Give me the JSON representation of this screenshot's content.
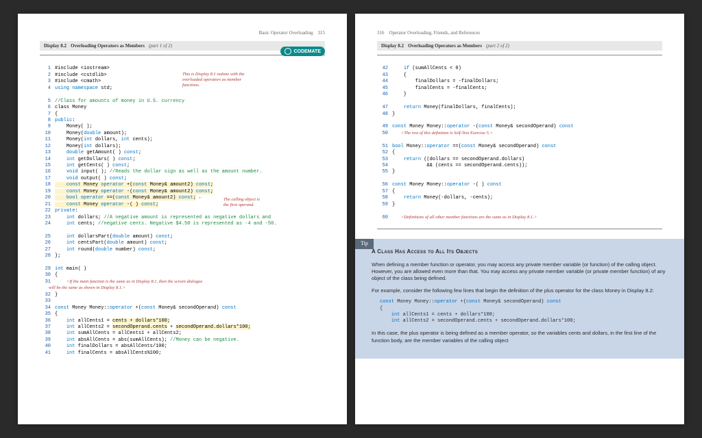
{
  "left": {
    "header_title": "Basic Operator Overloading",
    "header_page": "315",
    "display_label": "Display 8.2",
    "display_title": "Overloading Operators as Members",
    "display_part": "(part 1 of 2)",
    "badge": "CODEMATE",
    "callout1": "This is Display 8.1 redone with the\noverloaded operators as member\nfunctions.",
    "callout2": "The calling object is\nthe first operand.",
    "note_main": "<If the main function is the same as in Display 8.1, then the screen dialogue\n        will be the same as shown in Display 8.1.>",
    "lines": {
      "1": "#include <iostream>",
      "2": "#include <cstdlib>",
      "3": "#include <cmath>",
      "4_a": "using namespace",
      "4_b": " std;",
      "5": "//Class for amounts of money in U.S. currency",
      "6": "class Money",
      "7": "{",
      "8": "public",
      "9": "    Money( );",
      "10_a": "    Money(",
      "10_b": "double",
      "10_c": " amount);",
      "11_a": "    Money(",
      "11_b": "int",
      "11_c": " dollars, ",
      "11_d": "int",
      "11_e": " cents);",
      "12_a": "    Money(",
      "12_b": "int",
      "12_c": " dollars);",
      "13_a": "    ",
      "13_b": "double",
      "13_c": " getAmount( ) ",
      "13_d": "const",
      "14_a": "    ",
      "14_b": "int",
      "14_c": " getDollars( ) ",
      "14_d": "const",
      "15_a": "    ",
      "15_b": "int",
      "15_c": " getCents( ) ",
      "15_d": "const",
      "16_a": "    ",
      "16_b": "void",
      "16_c": " input( ); ",
      "16_d": "//Reads the dollar sign as well as the amount number.",
      "17_a": "    ",
      "17_b": "void",
      "17_c": " output( ) ",
      "17_d": "const",
      "18_a": "    ",
      "18_b": "const",
      "18_c": " Money ",
      "18_d": "operator",
      "18_e": " +(",
      "18_f": "const",
      "18_g": " Money& amount2) ",
      "18_h": "const",
      "19_a": "    ",
      "19_b": "const",
      "19_c": " Money ",
      "19_d": "operator",
      "19_e": " -(",
      "19_f": "const",
      "19_g": " Money& amount2) ",
      "19_h": "const",
      "20_a": "    ",
      "20_b": "bool operator",
      "20_c": " ==(",
      "20_d": "const",
      "20_e": " Money& amount2) ",
      "20_f": "const",
      "21_a": "    ",
      "21_b": "const",
      "21_c": " Money ",
      "21_d": "operator",
      "21_e": " -( ) ",
      "21_f": "const",
      "22": "private",
      "23_a": "    ",
      "23_b": "int",
      "23_c": " dollars; ",
      "23_d": "//A negative amount is represented as negative dollars and",
      "24_a": "    ",
      "24_b": "int",
      "24_c": " cents; ",
      "24_d": "//negative cents. Negative $4.50 is represented as -4 and -50.",
      "25_a": "    ",
      "25_b": "int",
      "25_c": " dollarsPart(",
      "25_d": "double",
      "25_e": " amount) ",
      "25_f": "const",
      "26_a": "    ",
      "26_b": "int",
      "26_c": " centsPart(",
      "26_d": "double",
      "26_e": " amount) ",
      "26_f": "const",
      "27_a": "    ",
      "27_b": "int",
      "27_c": " round(",
      "27_d": "double",
      "27_e": " number) ",
      "27_f": "const",
      "28": "};",
      "29_a": "int",
      "29_b": " main( )",
      "30": "{",
      "32": "}",
      "33": "",
      "34_a": "const",
      "34_b": " Money Money::",
      "34_c": "operator",
      "34_d": " +(",
      "34_e": "const",
      "34_f": " Money& secondOperand) ",
      "34_g": "const",
      "35": "{",
      "36_a": "    ",
      "36_b": "int",
      "36_c": " allCents1 = ",
      "36_d": "cents + dollars*100;",
      "37_a": "    ",
      "37_b": "int",
      "37_c": " allCents2 = ",
      "37_d": "secondOperand.cents",
      "37_e": " + ",
      "37_f": "secondOperand.dollars*100;",
      "38_a": "    ",
      "38_b": "int",
      "38_c": " sumAllCents = allCents1 + allCents2;",
      "39_a": "    ",
      "39_b": "int",
      "39_c": " absAllCents = abs(sumAllCents); ",
      "39_d": "//Money can be negative.",
      "40_a": "    ",
      "40_b": "int",
      "40_c": " finalDollars = absAllCents/100;",
      "41_a": "    ",
      "41_b": "int",
      "41_c": " finalCents = absAllCents%100;"
    }
  },
  "right": {
    "header_page": "316",
    "header_title": "Operator Overloading, Friends, and References",
    "display_label": "Display 8.2",
    "display_title": "Overloading Operators as Members",
    "display_part": "(part 2 of 2)",
    "lines": {
      "42_a": "    ",
      "42_b": "if",
      "42_c": " (sumAllCents < 0)",
      "43": "    {",
      "44": "        finalDollars = -finalDollars;",
      "45": "        finalCents = -finalCents;",
      "46": "    }",
      "47_a": "    ",
      "47_b": "return",
      "47_c": " Money(finalDollars, finalCents);",
      "48": "}",
      "49_a": "const",
      "49_b": " Money Money::",
      "49_c": "operator",
      "49_d": " -(",
      "49_e": "const",
      "49_f": " Money& secondOperand) ",
      "49_g": "const",
      "50": "        <The rest of this definition is Self-Test Exercise 5.>",
      "51_a": "bool",
      "51_b": " Money::",
      "51_c": "operator",
      "51_d": " ==(",
      "51_e": "const",
      "51_f": " Money& secondOperand) ",
      "51_g": "const",
      "52": "{",
      "53_a": "    ",
      "53_b": "return",
      "53_c": " ((dollars == secondOperand.dollars)",
      "54": "            && (cents == secondOperand.cents));",
      "55": "}",
      "56_a": "const",
      "56_b": " Money Money::",
      "56_c": "operator",
      "56_d": " -( ) ",
      "56_e": "const",
      "57": "{",
      "58_a": "    ",
      "58_b": "return",
      "58_c": " Money(-dollars, -cents);",
      "59": "}",
      "60": "        <Definitions of all other member functions are the same as in Display 8.1.>"
    },
    "tip": {
      "tab": "Tip",
      "heading": "A Class Has Access to All Its Objects",
      "p1": "When defining a member function or operator, you may access any private member variable (or function) of the calling object. However, you are allowed even more than that. You may access any private member variable (or private member function) of any object of the class being defined.",
      "p2": "For example, consider the following few lines that begin the definition of the plus operator for the class Money in Display 8.2:",
      "code_a": "const",
      "code_b": " Money Money::",
      "code_c": "operator",
      "code_d": " +(",
      "code_e": "const",
      "code_f": " Money& secondOperand) ",
      "code_g": "const",
      "code2": "{",
      "code3_a": "    ",
      "code3_b": "int",
      "code3_c": " allCents1 = cents + dollars*100;",
      "code4_a": "    ",
      "code4_b": "int",
      "code4_c": " allCents2 = secondOperand.cents + secondOperand.dollars*100;",
      "p3": "In this case, the plus operator is being defined as a member operator, so the variables cents and dollars, in the first line of the function body, are the member variables of the calling object"
    }
  }
}
